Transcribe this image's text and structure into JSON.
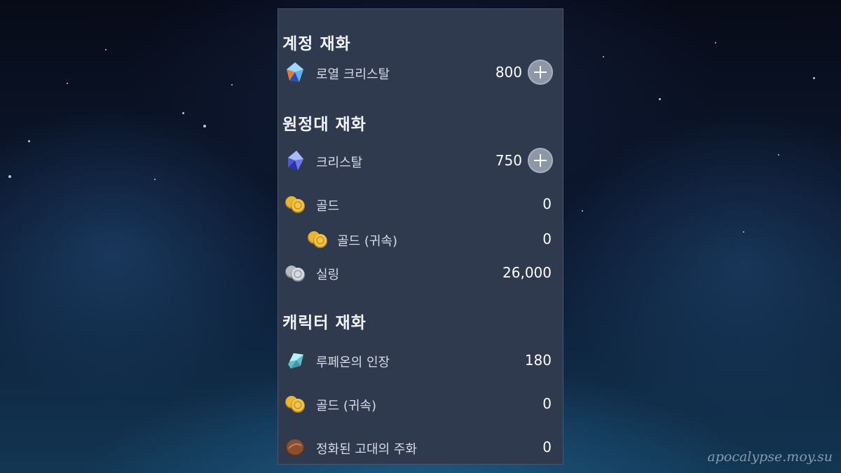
{
  "account_currency": {
    "title": "계정 재화",
    "items": [
      {
        "label": "로열 크리스탈",
        "value": "800",
        "icon": "royal-crystal-icon"
      }
    ]
  },
  "expedition_currency": {
    "title": "원정대 재화",
    "items": [
      {
        "label": "크리스탈",
        "value": "750",
        "icon": "crystal-icon"
      },
      {
        "label": "골드",
        "value": "0",
        "icon": "gold-icon"
      },
      {
        "label": "골드 (귀속)",
        "value": "0",
        "icon": "bound-gold-icon"
      },
      {
        "label": "실링",
        "value": "26,000",
        "icon": "silling-icon"
      }
    ]
  },
  "character_currency": {
    "title": "캐릭터 재화",
    "items": [
      {
        "label": "루페온의 인장",
        "value": "180",
        "icon": "lupeon-seal-icon"
      },
      {
        "label": "골드 (귀속)",
        "value": "0",
        "icon": "bound-gold-icon"
      },
      {
        "label": "정화된 고대의 주화",
        "value": "0",
        "icon": "ancient-coin-icon"
      }
    ]
  },
  "watermark": "apocalypse.moy.su",
  "colors": {
    "panel_bg": "#2f3a4f",
    "gold": "#e8b535",
    "crystal_blue": "#5a6ee8",
    "crystal_cyan": "#8fe0ea",
    "silver": "#c9ccd2",
    "bronze": "#8a4f2e"
  }
}
